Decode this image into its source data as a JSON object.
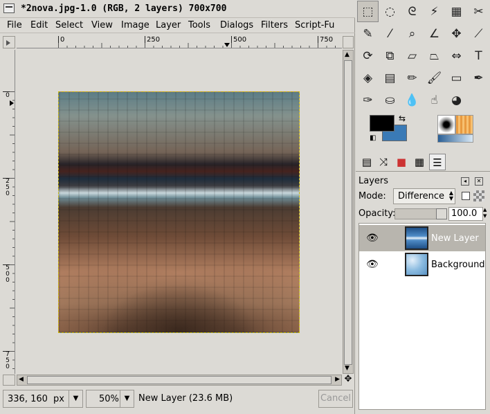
{
  "image_window": {
    "title": "*2nova.jpg-1.0 (RGB, 2 layers) 700x700",
    "menu": [
      "File",
      "Edit",
      "Select",
      "View",
      "Image",
      "Layer",
      "Tools",
      "Dialogs",
      "Filters",
      "Script-Fu"
    ],
    "menu_mnemonics": [
      "F",
      "E",
      "S",
      "V",
      "I",
      "L",
      "T",
      "D",
      "r",
      "S"
    ],
    "hruler_labels": [
      "0",
      "250",
      "500",
      "750"
    ],
    "vruler_labels": [
      "0",
      "2\n5\n0",
      "5\n0\n0",
      "7\n5\n0"
    ],
    "status": {
      "coords": "336, 160",
      "unit": "px",
      "zoom": "50%",
      "message": "New Layer (23.6 MB)",
      "cancel_label": "Cancel"
    }
  },
  "toolbox": {
    "tools": [
      {
        "name": "rect-select-icon",
        "glyph": "⬚"
      },
      {
        "name": "ellipse-select-icon",
        "glyph": "◌"
      },
      {
        "name": "free-select-icon",
        "glyph": "ᘓ"
      },
      {
        "name": "fuzzy-select-icon",
        "glyph": "⚡"
      },
      {
        "name": "select-by-color-icon",
        "glyph": "▦"
      },
      {
        "name": "scissors-select-icon",
        "glyph": "✂"
      },
      {
        "name": "paths-icon",
        "glyph": "✎"
      },
      {
        "name": "color-picker-icon",
        "glyph": "⁄"
      },
      {
        "name": "zoom-icon",
        "glyph": "⌕"
      },
      {
        "name": "measure-icon",
        "glyph": "∠"
      },
      {
        "name": "move-icon",
        "glyph": "✥"
      },
      {
        "name": "crop-icon",
        "glyph": "⟋"
      },
      {
        "name": "rotate-icon",
        "glyph": "⟳"
      },
      {
        "name": "scale-icon",
        "glyph": "⧉"
      },
      {
        "name": "shear-icon",
        "glyph": "▱"
      },
      {
        "name": "perspective-icon",
        "glyph": "⏢"
      },
      {
        "name": "flip-icon",
        "glyph": "⇔"
      },
      {
        "name": "text-icon",
        "glyph": "T"
      },
      {
        "name": "bucket-fill-icon",
        "glyph": "◈"
      },
      {
        "name": "blend-icon",
        "glyph": "▤"
      },
      {
        "name": "pencil-icon",
        "glyph": "✏"
      },
      {
        "name": "paintbrush-icon",
        "glyph": "🖌"
      },
      {
        "name": "eraser-icon",
        "glyph": "▭"
      },
      {
        "name": "airbrush-icon",
        "glyph": "✒"
      },
      {
        "name": "ink-icon",
        "glyph": "✑"
      },
      {
        "name": "clone-icon",
        "glyph": "⛀"
      },
      {
        "name": "blur-sharpen-icon",
        "glyph": "💧"
      },
      {
        "name": "smudge-icon",
        "glyph": "☝"
      },
      {
        "name": "dodge-burn-icon",
        "glyph": "◕"
      }
    ]
  },
  "dock": {
    "panel_title": "Layers",
    "mode_label": "Mode:",
    "mode_value": "Difference",
    "opacity_label": "Opacity:",
    "opacity_value": "100.0",
    "layers": [
      {
        "name": "New Layer",
        "selected": true,
        "visible": true
      },
      {
        "name": "Background",
        "selected": false,
        "visible": true
      }
    ]
  }
}
